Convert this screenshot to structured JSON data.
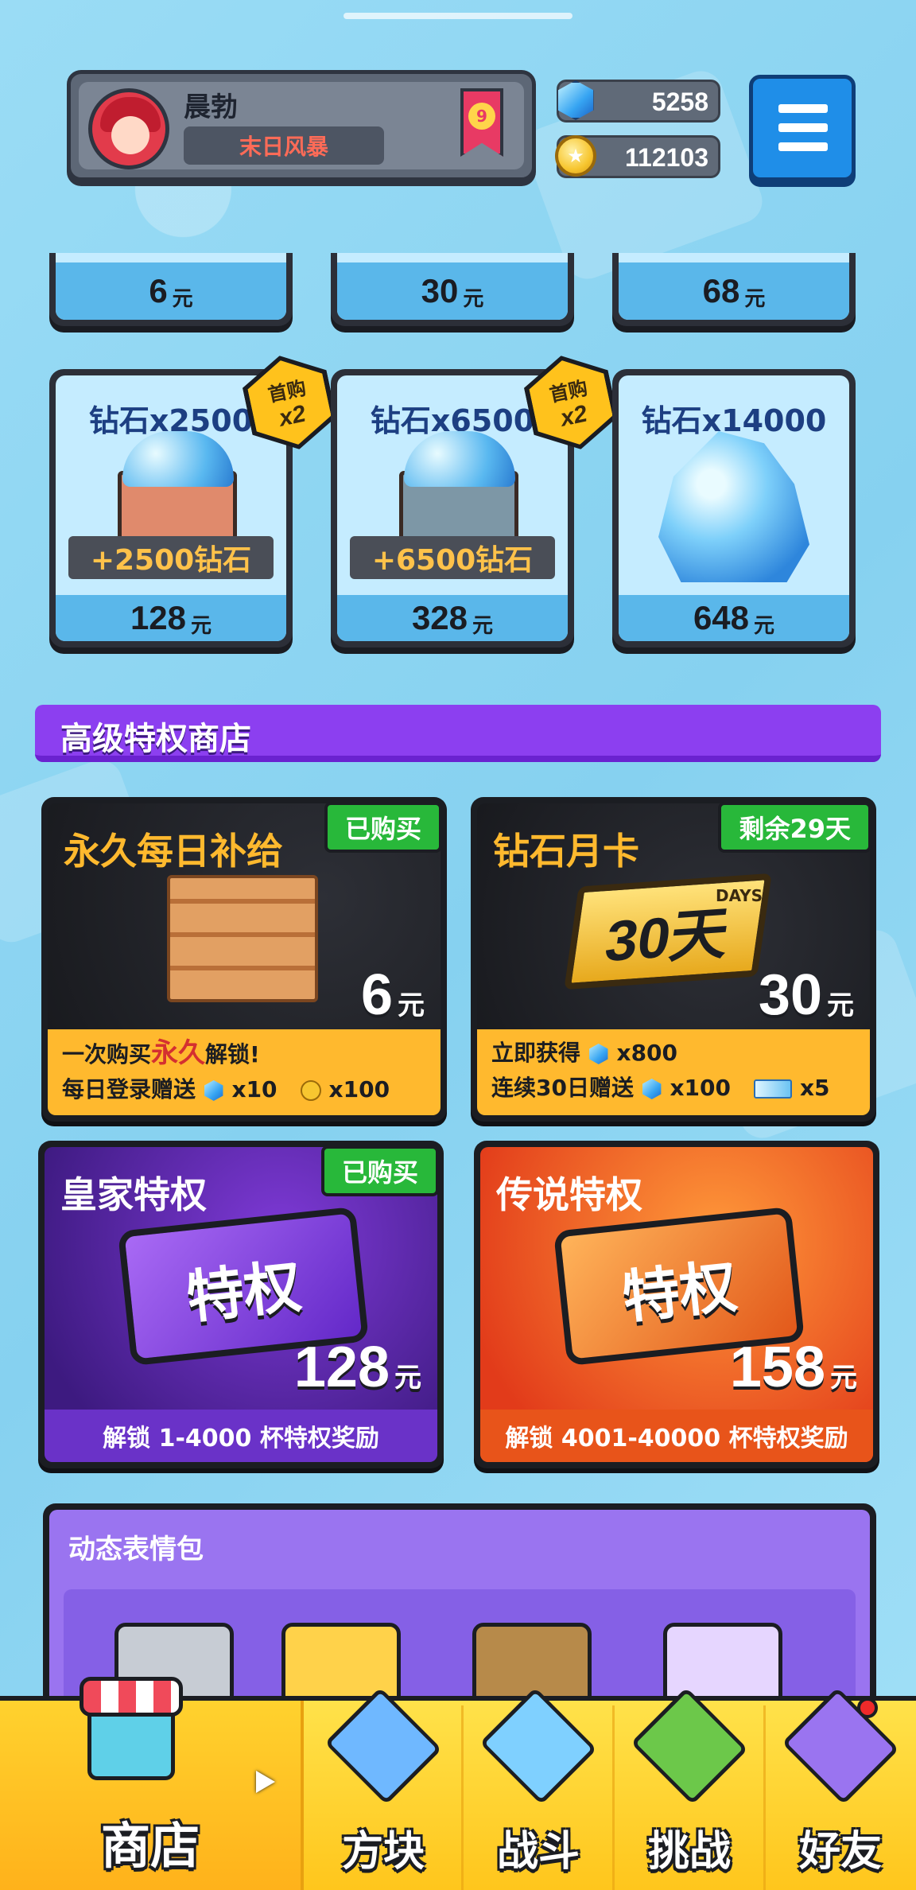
{
  "player": {
    "name": "晨勃",
    "title": "末日风暴",
    "rank": "9"
  },
  "currency": {
    "gems": "5258",
    "coins": "112103"
  },
  "top_packs": [
    {
      "price": "6",
      "unit": "元"
    },
    {
      "price": "30",
      "unit": "元"
    },
    {
      "price": "68",
      "unit": "元"
    }
  ],
  "gem_packs": [
    {
      "title": "钻石x2500",
      "bonus": "+2500钻石",
      "price": "128",
      "unit": "元",
      "badge_top": "首购",
      "badge_bottom": "x2"
    },
    {
      "title": "钻石x6500",
      "bonus": "+6500钻石",
      "price": "328",
      "unit": "元",
      "badge_top": "首购",
      "badge_bottom": "x2"
    },
    {
      "title": "钻石x14000",
      "price": "648",
      "unit": "元"
    }
  ],
  "privilege_section": {
    "title": "高级特权商店"
  },
  "privilege_cards": {
    "daily": {
      "title": "永久每日补给",
      "tag": "已购买",
      "price": "6",
      "unit": "元",
      "line1_a": "一次购买",
      "line1_b": "永久",
      "line1_c": "解锁!",
      "line2_a": "每日登录赠送",
      "line2_gems": "x10",
      "line2_coins": "x100"
    },
    "monthly": {
      "title": "钻石月卡",
      "tag": "剩余29天",
      "badge": "30天",
      "badge_small": "DAYS",
      "price": "30",
      "unit": "元",
      "line1_a": "立即获得",
      "line1_gems": "x800",
      "line2_a": "连续30日赠送",
      "line2_gems": "x100",
      "line2_tickets": "x5"
    },
    "royal": {
      "title": "皇家特权",
      "tag": "已购买",
      "badge": "特权",
      "price": "128",
      "unit": "元",
      "footer": "解锁 1-4000 杯特权奖励"
    },
    "legend": {
      "title": "传说特权",
      "badge": "特权",
      "price": "158",
      "unit": "元",
      "footer": "解锁 4001-40000 杯特权奖励"
    }
  },
  "emoji_section": {
    "title": "动态表情包"
  },
  "bottom_nav": [
    {
      "label": "商店",
      "icon": "shop-icon",
      "active": true
    },
    {
      "label": "方块",
      "icon": "block-icon"
    },
    {
      "label": "战斗",
      "icon": "battle-icon"
    },
    {
      "label": "挑战",
      "icon": "challenge-icon"
    },
    {
      "label": "好友",
      "icon": "friends-icon"
    }
  ],
  "colors": {
    "background": "#8fd6f2",
    "accent_purple": "#8c3ff0",
    "accent_gold": "#ffb92e",
    "green_tag": "#28b83a",
    "nav_yellow": "#ffc61c"
  }
}
